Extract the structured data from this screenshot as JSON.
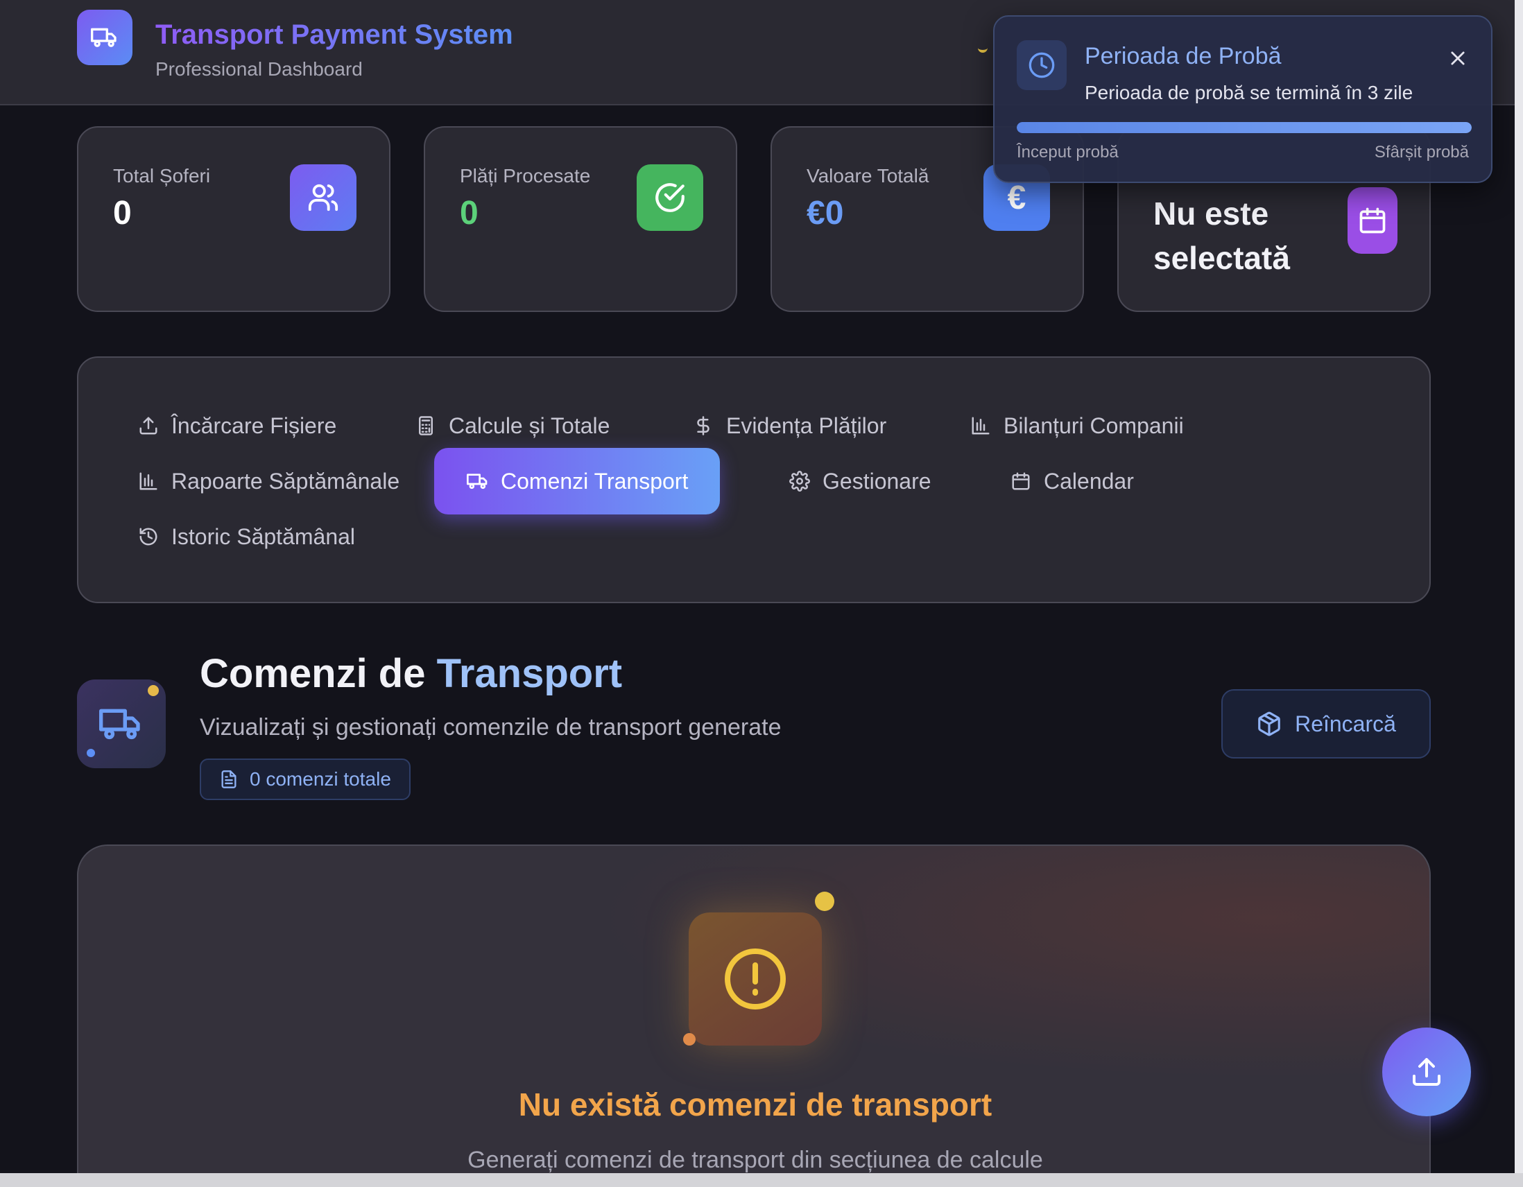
{
  "app": {
    "title": "Transport Payment System",
    "subtitle": "Professional Dashboard"
  },
  "stats": [
    {
      "label": "Total Șoferi",
      "value": "0",
      "color": "#ffffff",
      "icon": "users-icon"
    },
    {
      "label": "Plăți Procesate",
      "value": "0",
      "color": "#5cd17a",
      "icon": "check-circle-icon"
    },
    {
      "label": "Valoare Totală",
      "value": "€0",
      "color": "#6b9cf5",
      "icon": "euro-icon"
    },
    {
      "value": "Nu este selectată",
      "color": "#f2f2f7",
      "icon": "calendar-icon"
    }
  ],
  "tabs": [
    {
      "label": "Încărcare Fișiere",
      "icon": "upload-icon",
      "active": false
    },
    {
      "label": "Calcule și Totale",
      "icon": "calculator-icon",
      "active": false
    },
    {
      "label": "Evidența Plăților",
      "icon": "dollar-icon",
      "active": false
    },
    {
      "label": "Bilanțuri Companii",
      "icon": "bar-chart-icon",
      "active": false
    },
    {
      "label": "Rapoarte Săptămânale",
      "icon": "bar-chart-icon",
      "active": false
    },
    {
      "label": "Comenzi Transport",
      "icon": "truck-icon",
      "active": true
    },
    {
      "label": "Gestionare",
      "icon": "gear-icon",
      "active": false
    },
    {
      "label": "Calendar",
      "icon": "calendar-icon",
      "active": false
    },
    {
      "label": "Istoric Săptămânal",
      "icon": "history-icon",
      "active": false
    }
  ],
  "section": {
    "title_main": "Comenzi de ",
    "title_accent": "Transport",
    "description": "Vizualizați și gestionați comenzile de transport generate",
    "count_label": "0 comenzi totale",
    "reload_label": "Reîncarcă"
  },
  "empty": {
    "title": "Nu există comenzi de transport",
    "description": "Generați comenzi de transport din secțiunea de calcule"
  },
  "toast": {
    "title": "Perioada de Probă",
    "message": "Perioada de probă se termină în 3 zile",
    "start_label": "Început probă",
    "end_label": "Sfârșit probă",
    "progress": 1.0
  },
  "colors": {
    "accent_purple": "#7b52ef",
    "accent_blue": "#69a0f6",
    "warning": "#f2a54b"
  }
}
